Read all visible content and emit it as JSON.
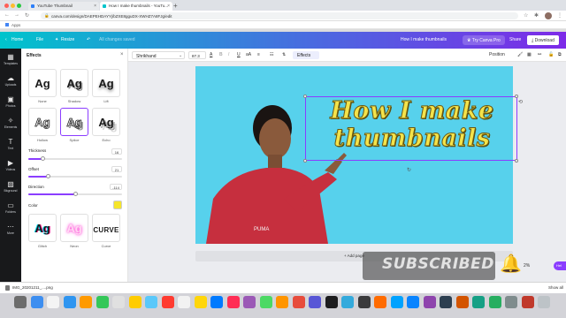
{
  "browser": {
    "tabs": [
      {
        "label": "YouTube Thumbnail",
        "favicon_color": "#2d7ff9"
      },
      {
        "label": "How I make thumbnails - YouTu...",
        "favicon_color": "#00c4cc"
      }
    ],
    "new_tab": "+",
    "url": "canva.com/design/DAEPEHDAYYj/bZXE8gguDX-XWHZ7A8FJg/edit",
    "bookmarks_label": "Apps"
  },
  "header": {
    "home": "Home",
    "file": "File",
    "resize": "Resize",
    "saved": "All changes saved",
    "doc_title": "How I make thumbnails",
    "try_pro": "Try Canva Pro",
    "share": "Share",
    "download": "Download"
  },
  "rail": {
    "items": [
      {
        "label": "Templates",
        "icon": "templates-icon",
        "glyph": "▦"
      },
      {
        "label": "Uploads",
        "icon": "upload-icon",
        "glyph": "☁"
      },
      {
        "label": "Photos",
        "icon": "photos-icon",
        "glyph": "▣"
      },
      {
        "label": "Elements",
        "icon": "elements-icon",
        "glyph": "✧"
      },
      {
        "label": "Text",
        "icon": "text-icon",
        "glyph": "T"
      },
      {
        "label": "Videos",
        "icon": "video-icon",
        "glyph": "▶"
      },
      {
        "label": "Bkground",
        "icon": "background-icon",
        "glyph": "▨"
      },
      {
        "label": "Folders",
        "icon": "folder-icon",
        "glyph": "▭"
      },
      {
        "label": "More",
        "icon": "more-icon",
        "glyph": "⋯"
      }
    ]
  },
  "panel": {
    "title": "Effects",
    "effects": [
      {
        "label": "None",
        "style": "none"
      },
      {
        "label": "Shadow",
        "style": "shadow"
      },
      {
        "label": "Lift",
        "style": "lift"
      },
      {
        "label": "Hollow",
        "style": "hollow"
      },
      {
        "label": "Splice",
        "style": "splice"
      },
      {
        "label": "Echo",
        "style": "echo"
      },
      {
        "label": "Glitch",
        "style": "glitch"
      },
      {
        "label": "Neon",
        "style": "neon"
      },
      {
        "label": "Curve",
        "style": "curve"
      }
    ],
    "effect_sample": "Ag",
    "curve_sample": "CURVE",
    "sliders": {
      "thickness": {
        "label": "Thickness",
        "value": "16",
        "fraction": 0.16
      },
      "offset": {
        "label": "Offset",
        "value": "21",
        "fraction": 0.21
      },
      "direction": {
        "label": "Direction",
        "value": "-114",
        "fraction": 0.5
      }
    },
    "color_label": "Color",
    "color_value": "#f5e52b"
  },
  "toolbar": {
    "font": "Shrikhand",
    "font_size": "87.3",
    "effects": "Effects",
    "position": "Position"
  },
  "canvas": {
    "headline": "How I make thumbnails",
    "bg_color": "#57d1ec",
    "text_color": "#f4e34b",
    "add_page": "+ Add page",
    "zoom": "2%"
  },
  "overlay": {
    "subscribed": "SUBSCRIBED"
  },
  "downloads": {
    "file": "IMG_20201211_....png",
    "show_all": "Show all"
  }
}
